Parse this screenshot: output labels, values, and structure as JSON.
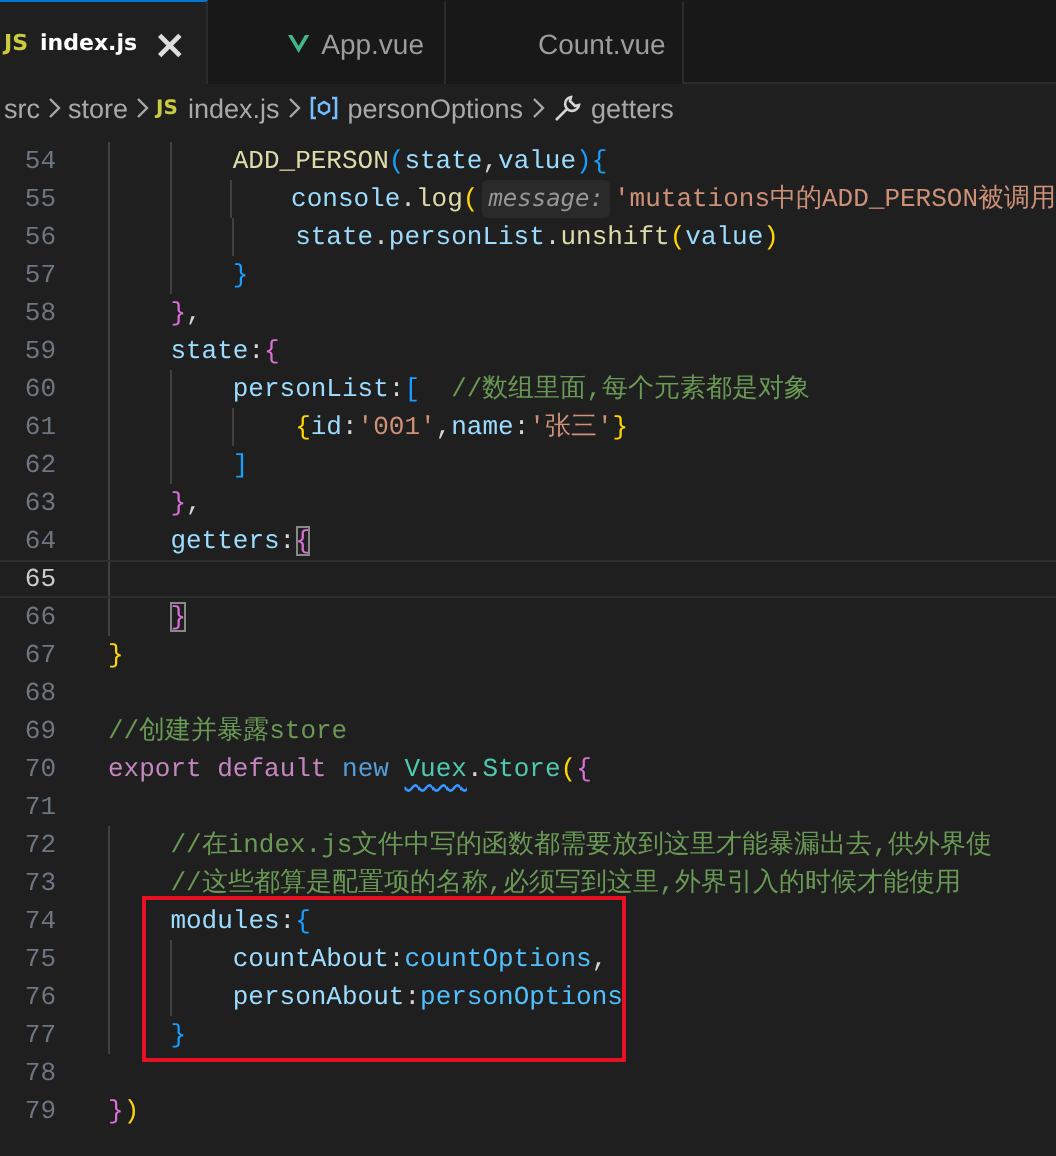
{
  "tabs": [
    {
      "kind": "js",
      "icon_text": "JS",
      "label": "index.js",
      "close": "×",
      "selected": true
    },
    {
      "kind": "vue",
      "label": "App.vue",
      "selected": false
    },
    {
      "kind": "vue",
      "label": "Count.vue",
      "selected": false
    }
  ],
  "breadcrumb": [
    {
      "kind": "folder",
      "label": "src"
    },
    {
      "kind": "folder",
      "label": "store"
    },
    {
      "kind": "js",
      "icon_text": "JS",
      "label": "index.js"
    },
    {
      "kind": "variable",
      "label": "personOptions"
    },
    {
      "kind": "property",
      "label": "getters"
    }
  ],
  "editor": {
    "lines": [
      {
        "number": "54",
        "current": false,
        "boxed": false,
        "tokens": [
          {
            "kind": "fn",
            "text": "        ADD_PERSON"
          },
          {
            "kind": "b3",
            "text": "("
          },
          {
            "kind": "var",
            "text": "state"
          },
          {
            "kind": "punc",
            "text": ","
          },
          {
            "kind": "var",
            "text": "value"
          },
          {
            "kind": "b3",
            "text": ")"
          },
          {
            "kind": "b3",
            "text": "{"
          }
        ]
      },
      {
        "number": "55",
        "current": false,
        "boxed": false,
        "tokens": [
          {
            "kind": "var",
            "text": "            console"
          },
          {
            "kind": "punc",
            "text": "."
          },
          {
            "kind": "fn",
            "text": "log"
          },
          {
            "kind": "b1",
            "text": "("
          },
          {
            "kind": "hint",
            "text": "message:"
          },
          {
            "kind": "str",
            "text": "'mutations中的ADD_PERSON被调用"
          }
        ]
      },
      {
        "number": "56",
        "current": false,
        "boxed": false,
        "tokens": [
          {
            "kind": "var",
            "text": "            state"
          },
          {
            "kind": "punc",
            "text": "."
          },
          {
            "kind": "var",
            "text": "personList"
          },
          {
            "kind": "punc",
            "text": "."
          },
          {
            "kind": "fn",
            "text": "unshift"
          },
          {
            "kind": "b1",
            "text": "("
          },
          {
            "kind": "var",
            "text": "value"
          },
          {
            "kind": "b1",
            "text": ")"
          }
        ]
      },
      {
        "number": "57",
        "current": false,
        "boxed": false,
        "tokens": [
          {
            "kind": "b3",
            "text": "        }"
          }
        ]
      },
      {
        "number": "58",
        "current": false,
        "boxed": false,
        "tokens": [
          {
            "kind": "b2",
            "text": "    }"
          },
          {
            "kind": "punc",
            "text": ","
          }
        ]
      },
      {
        "number": "59",
        "current": false,
        "boxed": false,
        "tokens": [
          {
            "kind": "var",
            "text": "    state"
          },
          {
            "kind": "punc",
            "text": ":"
          },
          {
            "kind": "b2",
            "text": "{"
          }
        ]
      },
      {
        "number": "60",
        "current": false,
        "boxed": false,
        "tokens": [
          {
            "kind": "var",
            "text": "        personList"
          },
          {
            "kind": "punc",
            "text": ":"
          },
          {
            "kind": "b3",
            "text": "["
          },
          {
            "kind": "cmt",
            "text": "  //数组里面,每个元素都是对象"
          }
        ]
      },
      {
        "number": "61",
        "current": false,
        "boxed": false,
        "tokens": [
          {
            "kind": "b1",
            "text": "            {"
          },
          {
            "kind": "var",
            "text": "id"
          },
          {
            "kind": "punc",
            "text": ":"
          },
          {
            "kind": "str",
            "text": "'001'"
          },
          {
            "kind": "punc",
            "text": ","
          },
          {
            "kind": "var",
            "text": "name"
          },
          {
            "kind": "punc",
            "text": ":"
          },
          {
            "kind": "str",
            "text": "'张三'"
          },
          {
            "kind": "b1",
            "text": "}"
          }
        ]
      },
      {
        "number": "62",
        "current": false,
        "boxed": false,
        "tokens": [
          {
            "kind": "b3",
            "text": "        ]"
          }
        ]
      },
      {
        "number": "63",
        "current": false,
        "boxed": false,
        "tokens": [
          {
            "kind": "b2",
            "text": "    }"
          },
          {
            "kind": "punc",
            "text": ","
          }
        ]
      },
      {
        "number": "64",
        "current": false,
        "boxed": false,
        "tokens": [
          {
            "kind": "var",
            "text": "    getters"
          },
          {
            "kind": "punc",
            "text": ":"
          },
          {
            "kind": "b2-match",
            "text": "{"
          }
        ]
      },
      {
        "number": "65",
        "current": true,
        "boxed": false
      },
      {
        "number": "66",
        "current": false,
        "boxed": false,
        "tokens": [
          {
            "kind": "b2-match",
            "text": "    }"
          }
        ]
      },
      {
        "number": "67",
        "current": false,
        "boxed": false,
        "tokens": [
          {
            "kind": "b1",
            "text": "}"
          }
        ]
      },
      {
        "number": "68",
        "current": false,
        "boxed": false
      },
      {
        "number": "69",
        "current": false,
        "boxed": false,
        "tokens": [
          {
            "kind": "cmt",
            "text": "//创建并暴露store"
          }
        ]
      },
      {
        "number": "70",
        "current": false,
        "boxed": false,
        "tokens": [
          {
            "kind": "ctrl",
            "text": "export default "
          },
          {
            "kind": "kw",
            "text": "new "
          },
          {
            "kind": "type-squiggle",
            "text": "Vuex"
          },
          {
            "kind": "punc",
            "text": "."
          },
          {
            "kind": "type",
            "text": "Store"
          },
          {
            "kind": "b1",
            "text": "("
          },
          {
            "kind": "b2",
            "text": "{"
          }
        ]
      },
      {
        "number": "71",
        "current": false,
        "boxed": false
      },
      {
        "number": "72",
        "current": false,
        "boxed": false,
        "tokens": [
          {
            "kind": "cmt",
            "text": "    //在index.js文件中写的函数都需要放到这里才能暴漏出去,供外界使"
          }
        ]
      },
      {
        "number": "73",
        "current": false,
        "boxed": false,
        "tokens": [
          {
            "kind": "cmt",
            "text": "    //这些都算是配置项的名称,必须写到这里,外界引入的时候才能使用"
          }
        ]
      },
      {
        "number": "74",
        "current": false,
        "boxed": true,
        "tokens": [
          {
            "kind": "var",
            "text": "    modules"
          },
          {
            "kind": "punc",
            "text": ":"
          },
          {
            "kind": "b3",
            "text": "{"
          }
        ]
      },
      {
        "number": "75",
        "current": false,
        "boxed": true,
        "tokens": [
          {
            "kind": "var",
            "text": "        countAbout"
          },
          {
            "kind": "punc",
            "text": ":"
          },
          {
            "kind": "const",
            "text": "countOptions"
          },
          {
            "kind": "punc",
            "text": ","
          }
        ]
      },
      {
        "number": "76",
        "current": false,
        "boxed": true,
        "tokens": [
          {
            "kind": "var",
            "text": "        personAbout"
          },
          {
            "kind": "punc",
            "text": ":"
          },
          {
            "kind": "const",
            "text": "personOptions"
          }
        ]
      },
      {
        "number": "77",
        "current": false,
        "boxed": true,
        "tokens": [
          {
            "kind": "b3",
            "text": "    }"
          }
        ]
      },
      {
        "number": "78",
        "current": false,
        "boxed": false
      },
      {
        "number": "79",
        "current": false,
        "boxed": false,
        "tokens": [
          {
            "kind": "b2",
            "text": "}"
          },
          {
            "kind": "b1",
            "text": ")"
          }
        ]
      }
    ]
  }
}
